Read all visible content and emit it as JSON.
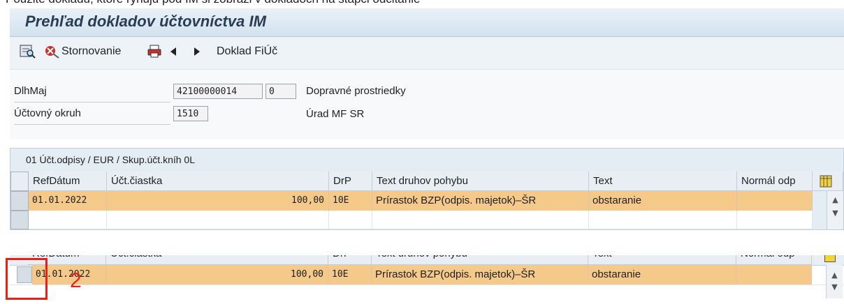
{
  "header_cut_text": "Pouzite dokladu, ktore ryhuju pod IM si zobrazi v dokladoch na stapci odcitanie",
  "title": "Prehľad dokladov účtovníctva IM",
  "toolbar": {
    "display_icon": "display-doc-icon",
    "reverse_icon": "reverse-icon",
    "reverse_label": "Stornovanie",
    "print_icon": "print-icon",
    "prev_icon": "prev-arrow-icon",
    "next_icon": "next-arrow-icon",
    "doc_label": "Doklad FiÚč"
  },
  "form": {
    "asset_label": "DlhMaj",
    "asset_number": "42100000014",
    "asset_sub": "0",
    "asset_desc": "Dopravné prostriedky",
    "company_label": "Účtovný okruh",
    "company_code": "1510",
    "company_desc": "Úrad MF SR"
  },
  "table": {
    "caption": "01 Účt.odpisy / EUR / Skup.účt.kníh 0L",
    "columns": [
      "RefDátum",
      "Účt.čiastka",
      "DrP",
      "Text druhov pohybu",
      "Text",
      "Normál odp"
    ],
    "row": {
      "ref_date": "01.01.2022",
      "amount": "100,00",
      "drp": "10E",
      "move_text": "Prírastok BZP(odpis. majetok)–ŠR",
      "text": "obstaranie",
      "normal": ""
    }
  },
  "zoom": {
    "columns": [
      "RefDátum",
      "Účt.čiastka",
      "DrP",
      "Text druhov pohybu",
      "Text",
      "Normál odp"
    ],
    "ref_date": "01.01.2022",
    "amount": "100,00",
    "drp": "10E",
    "move_text": "Prírastok BZP(odpis. majetok)–ŠR",
    "text": "obstaranie",
    "annotation_number": "2"
  },
  "colors": {
    "selected_row": "#f4c98a",
    "annotation_red": "#e2231a"
  }
}
